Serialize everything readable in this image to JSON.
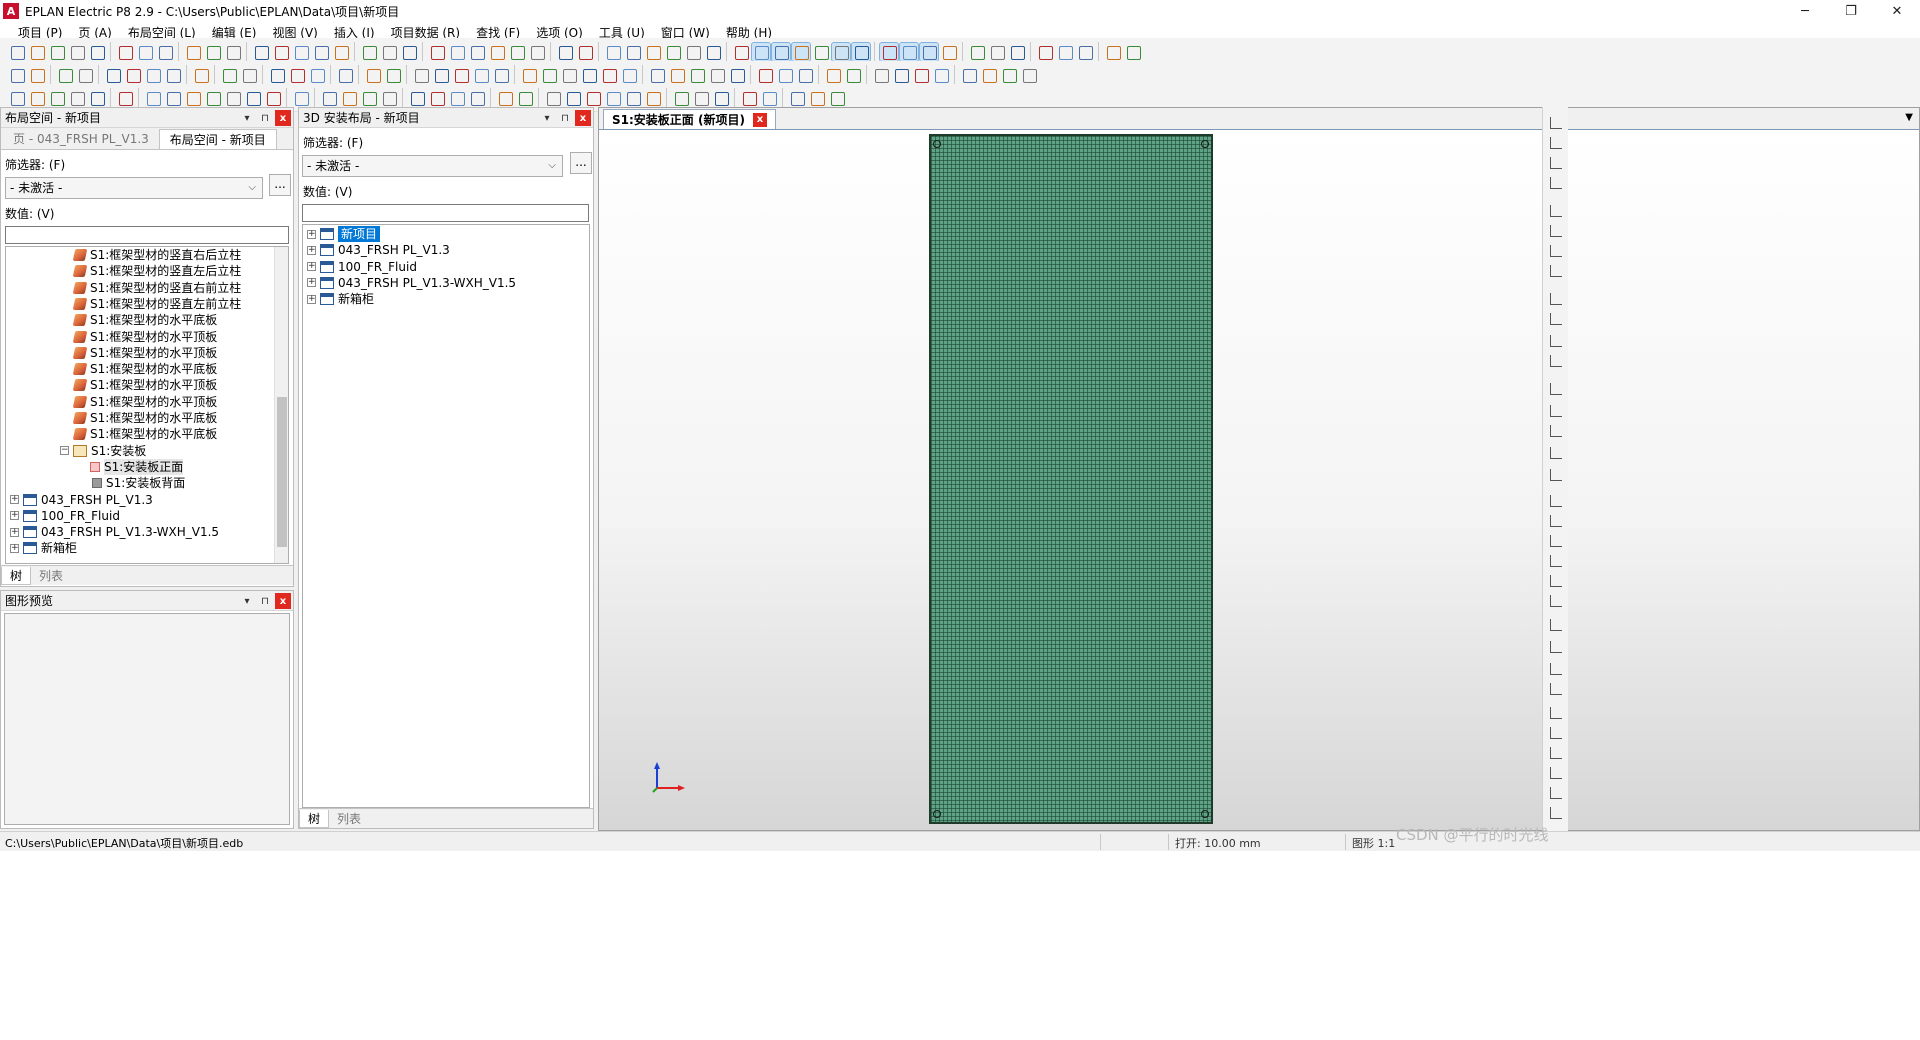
{
  "window": {
    "title": "EPLAN Electric P8 2.9 - C:\\Users\\Public\\EPLAN\\Data\\项目\\新项目",
    "logo": "A",
    "controls": [
      "─",
      "❐",
      "✕"
    ]
  },
  "menu": [
    "项目 (P)",
    "页 (A)",
    "布局空间 (L)",
    "编辑 (E)",
    "视图 (V)",
    "插入 (I)",
    "项目数据 (R)",
    "查找 (F)",
    "选项 (O)",
    "工具 (U)",
    "窗口 (W)",
    "帮助 (H)"
  ],
  "layout_panel": {
    "title": "布局空间 - 新项目",
    "tabs": [
      "页 - 043_FRSH PL_V1.3",
      "布局空间 - 新项目"
    ],
    "filter_label": "筛选器: (F)",
    "filter_value": "- 未激活 -",
    "dots": "...",
    "value_label": "数值: (V)",
    "tree": [
      {
        "label": "S1:框架型材的竖直右后立柱",
        "icon": "part"
      },
      {
        "label": "S1:框架型材的竖直左后立柱",
        "icon": "part"
      },
      {
        "label": "S1:框架型材的竖直右前立柱",
        "icon": "part"
      },
      {
        "label": "S1:框架型材的竖直左前立柱",
        "icon": "part"
      },
      {
        "label": "S1:框架型材的水平底板",
        "icon": "part"
      },
      {
        "label": "S1:框架型材的水平顶板",
        "icon": "part"
      },
      {
        "label": "S1:框架型材的水平顶板",
        "icon": "part"
      },
      {
        "label": "S1:框架型材的水平底板",
        "icon": "part"
      },
      {
        "label": "S1:框架型材的水平顶板",
        "icon": "part"
      },
      {
        "label": "S1:框架型材的水平顶板",
        "icon": "part"
      },
      {
        "label": "S1:框架型材的水平底板",
        "icon": "part"
      },
      {
        "label": "S1:框架型材的水平底板",
        "icon": "part"
      },
      {
        "label": "S1:安装板",
        "icon": "frame",
        "expander": "−"
      },
      {
        "label": "S1:安装板正面",
        "icon": "plate-red"
      },
      {
        "label": "S1:安装板背面",
        "icon": "plate"
      },
      {
        "label": "043_FRSH PL_V1.3",
        "icon": "proj",
        "expander": "+"
      },
      {
        "label": "100_FR_Fluid",
        "icon": "proj",
        "expander": "+"
      },
      {
        "label": "043_FRSH PL_V1.3-WXH_V1.5",
        "icon": "proj",
        "expander": "+"
      },
      {
        "label": "新箱柜",
        "icon": "proj",
        "expander": "+"
      }
    ],
    "bottom_tabs": [
      "树",
      "列表"
    ]
  },
  "preview_panel": {
    "title": "图形预览"
  },
  "layout3d_panel": {
    "title": "3D 安装布局 - 新项目",
    "filter_label": "筛选器: (F)",
    "filter_value": "- 未激活 -",
    "dots": "...",
    "value_label": "数值: (V)",
    "tree": [
      {
        "label": "新项目",
        "selected": true
      },
      {
        "label": "043_FRSH PL_V1.3"
      },
      {
        "label": "100_FR_Fluid"
      },
      {
        "label": "043_FRSH PL_V1.3-WXH_V1.5"
      },
      {
        "label": "新箱柜"
      }
    ],
    "bottom_tabs": [
      "树",
      "列表"
    ]
  },
  "document": {
    "tab_title": "S1:安装板正面 (新项目)",
    "close": "x",
    "plate_color": "#5ea386"
  },
  "statusbar": {
    "path": "C:\\Users\\Public\\EPLAN\\Data\\项目\\新项目.edb",
    "open": "打开: 10.00 mm",
    "scale": "图形 1:1",
    "watermark": "CSDN @平行的时光线"
  },
  "panel_buttons": {
    "pin": "▾",
    "dock": "⊓",
    "close": "x"
  }
}
